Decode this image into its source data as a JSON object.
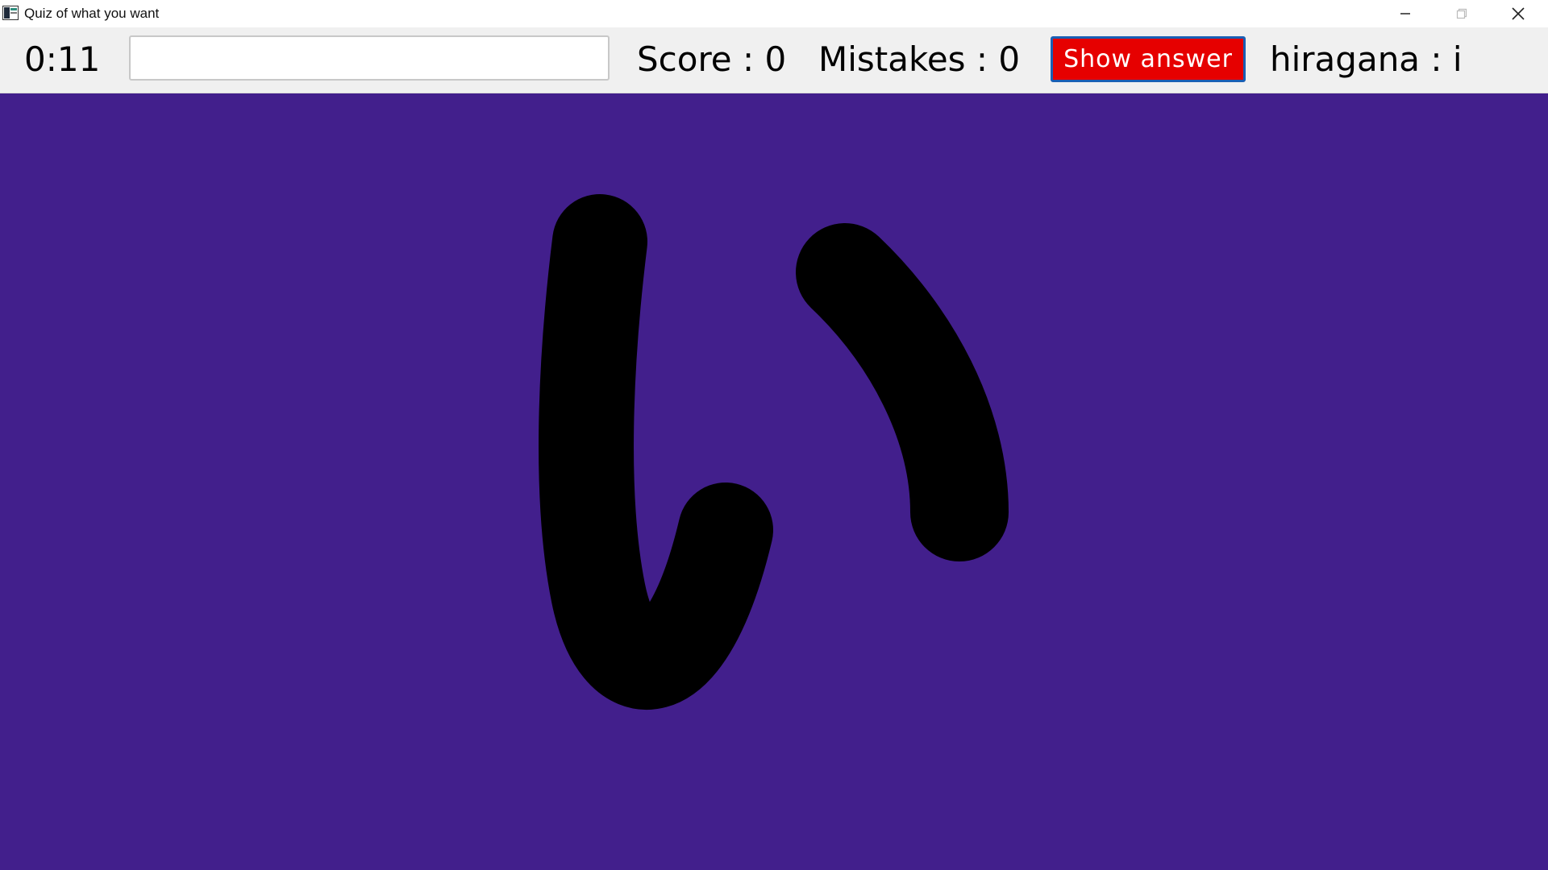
{
  "window": {
    "title": "Quiz of what you want",
    "icon": "app-icon"
  },
  "toolbar": {
    "timer": "0:11",
    "answer_input": {
      "value": "",
      "placeholder": ""
    },
    "score_text": "Score : 0",
    "mistakes_text": "Mistakes : 0",
    "show_answer_label": "Show answer",
    "quiz_label": "hiragana : i"
  },
  "canvas": {
    "character": "い",
    "background_color": "#421f8c",
    "stroke_color": "#000000"
  },
  "colors": {
    "toolbar_bg": "#f0f0f0",
    "button_bg": "#e60000",
    "button_border": "#1a5fb4"
  }
}
